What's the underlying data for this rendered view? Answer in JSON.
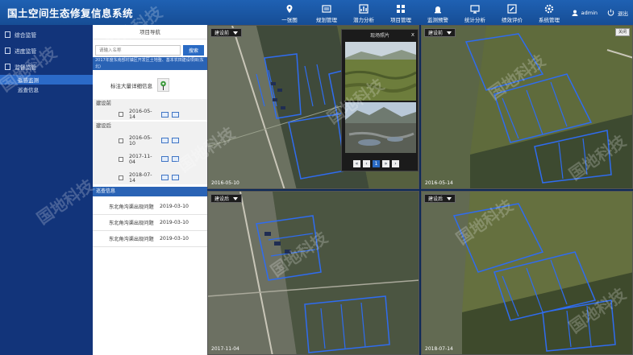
{
  "header": {
    "title": "国土空间生态修复信息系统",
    "nav": [
      {
        "label": "一张图",
        "icon": "map-pin-icon"
      },
      {
        "label": "规划管理",
        "icon": "folder-icon"
      },
      {
        "label": "潜力分析",
        "icon": "chart-icon"
      },
      {
        "label": "项目管理",
        "icon": "grid-icon"
      },
      {
        "label": "监测预警",
        "icon": "alarm-icon"
      },
      {
        "label": "统计分析",
        "icon": "monitor-icon"
      },
      {
        "label": "绩效评价",
        "icon": "edit-icon"
      },
      {
        "label": "系统管理",
        "icon": "gear-icon"
      }
    ],
    "user": "admin",
    "logout": "退出"
  },
  "sidebar": {
    "items": [
      {
        "label": "综合监管"
      },
      {
        "label": "进度监管"
      },
      {
        "label": "监督监管"
      }
    ],
    "subitems": [
      {
        "label": "遥感监测",
        "active": true
      },
      {
        "label": "巡查信息",
        "active": false
      }
    ]
  },
  "panel": {
    "title": "项目导航",
    "search": {
      "placeholder": "请输入名称",
      "button": "搜索"
    },
    "project_text": "2017年度东南部村镇区开发区土地整、基本农田建设项目(东北)",
    "flag_label": "标注大量详细信息",
    "before_label": "建设前",
    "before_dates": [
      "2016-05-14"
    ],
    "after_label": "建设后",
    "after_dates": [
      "2016-05-10",
      "2017-11-04",
      "2018-07-14"
    ],
    "result_title": "巡查信息",
    "results": [
      {
        "name": "东北角沟渠出现问题",
        "date": "2019-03-10"
      },
      {
        "name": "东北角沟渠出现问题",
        "date": "2019-03-10"
      },
      {
        "name": "东北角沟渠出现问题",
        "date": "2019-03-10"
      }
    ]
  },
  "maps": [
    {
      "phase": "建设前",
      "date": "2016-05-10"
    },
    {
      "phase": "建设前",
      "date": "2016-05-14"
    },
    {
      "phase": "建设后",
      "date": "2017-11-04"
    },
    {
      "phase": "建设后",
      "date": "2018-07-14"
    }
  ],
  "map_toggle": "关闭",
  "popup": {
    "title": "现场照片",
    "close": "x",
    "pages": [
      "«",
      "‹",
      "1",
      "»",
      "›"
    ],
    "active_page": "1"
  },
  "watermark": "国地科技"
}
